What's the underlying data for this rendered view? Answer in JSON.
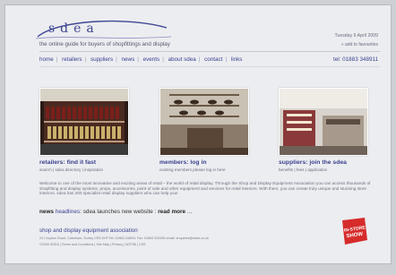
{
  "brand": {
    "logo_text": "sdea",
    "tagline": "the online guide for buyers of shopfittings and display"
  },
  "header": {
    "date": "Tuesday 6 April 2009",
    "favourites": "» add to favourites"
  },
  "nav": {
    "items": [
      {
        "label": "home"
      },
      {
        "label": "retailers"
      },
      {
        "label": "suppliers"
      },
      {
        "label": "news"
      },
      {
        "label": "events"
      },
      {
        "label": "about sdea"
      },
      {
        "label": "contact"
      },
      {
        "label": "links"
      }
    ],
    "tel": "tel: 01883 348911"
  },
  "features": [
    {
      "title": "retailers: find it fast",
      "sub": "search  |  sdea directory  |  inspiration"
    },
    {
      "title": "members: log in",
      "sub": "existing members please log in here"
    },
    {
      "title": "suppliers: join the sdea",
      "sub": "benefits  |  fees  |  application"
    }
  ],
  "intro": "Welcome to one of the most innovative and exciting areas of retail – the world of retail display. Through the Shop and Display Equipment Association you can access thousands of shopfitting and display systems, props, accessories, point of sale and other equipment and services for retail interiors. With them, you can create truly unique and stunning store interiors. sdea has 200 specialist retail display suppliers who can help you!",
  "news": {
    "bold": "news",
    "label": "headlines",
    "text": ": sdea launches new website : ",
    "more": "read more"
  },
  "footer": {
    "company": "shop and display equipment association",
    "address": "24 Croydon Road, Caterham, Surrey CR3 6YR  Tel: 01883 348911  Fax: 01883 343435  email: enquiries@sdea.co.uk",
    "links": "©2009 SDEA  |  Terms and Conditions  |  Site Map  |  Privacy  |  W3T56  |  CSS"
  },
  "badge": {
    "line1": "IN-STORE",
    "line2": "SHOW"
  },
  "colors": {
    "brand_blue": "#3f4794",
    "badge_red": "#d62b2b",
    "background": "#ecedf0"
  }
}
